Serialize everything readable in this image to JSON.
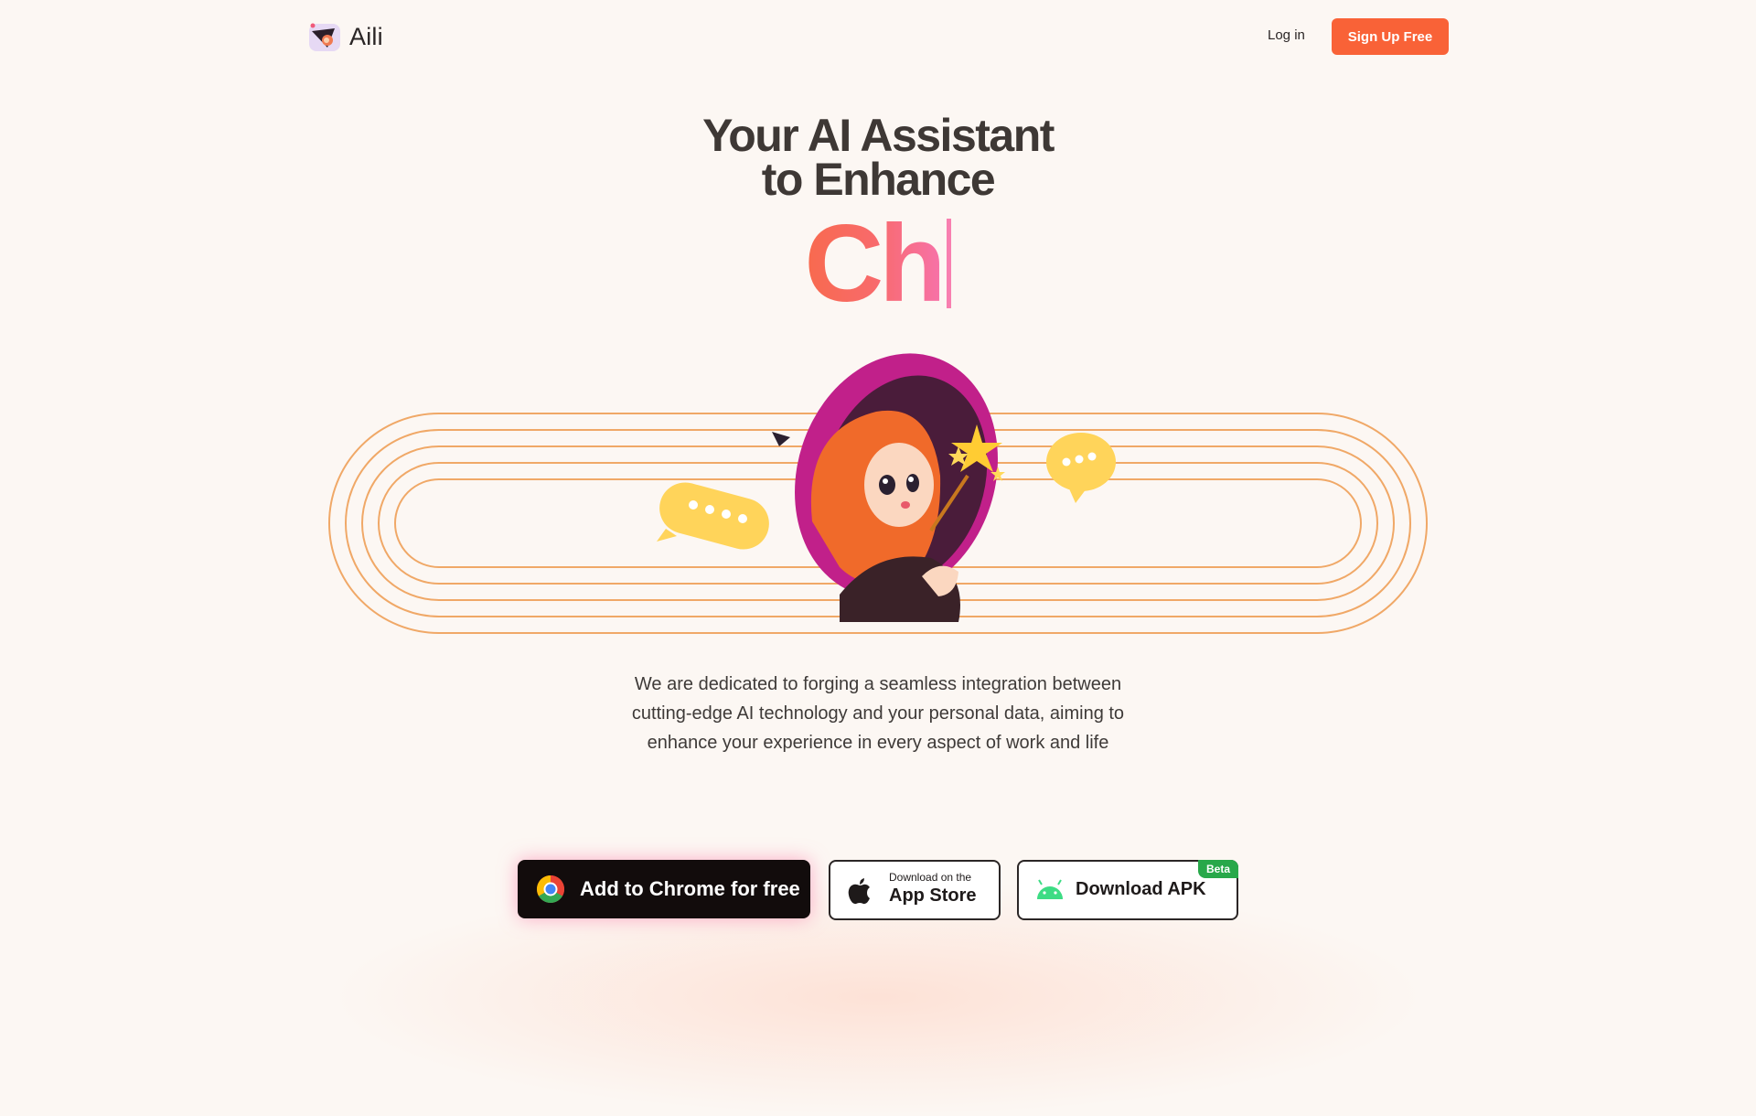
{
  "brand": {
    "name": "Aili"
  },
  "nav": {
    "login_label": "Log in",
    "signup_label": "Sign Up Free"
  },
  "hero": {
    "title_line1": "Your AI Assistant",
    "title_line2": "to Enhance",
    "typed_text": "Ch"
  },
  "description": "We are dedicated to forging a seamless integration between cutting-edge AI technology and your personal data, aiming to enhance your experience in every aspect of work and life",
  "downloads": {
    "chrome_label": "Add to Chrome for free",
    "appstore_small": "Download on the",
    "appstore_big": "App Store",
    "apk_label": "Download APK",
    "apk_badge": "Beta"
  },
  "colors": {
    "background": "#fcf7f3",
    "accent": "#f96237",
    "track_lines": "#f0a867",
    "beta_badge": "#28a84a"
  },
  "icons": {
    "logo": "witch-hat-logo-icon",
    "chrome": "chrome-icon",
    "apple": "apple-icon",
    "android": "android-icon"
  }
}
